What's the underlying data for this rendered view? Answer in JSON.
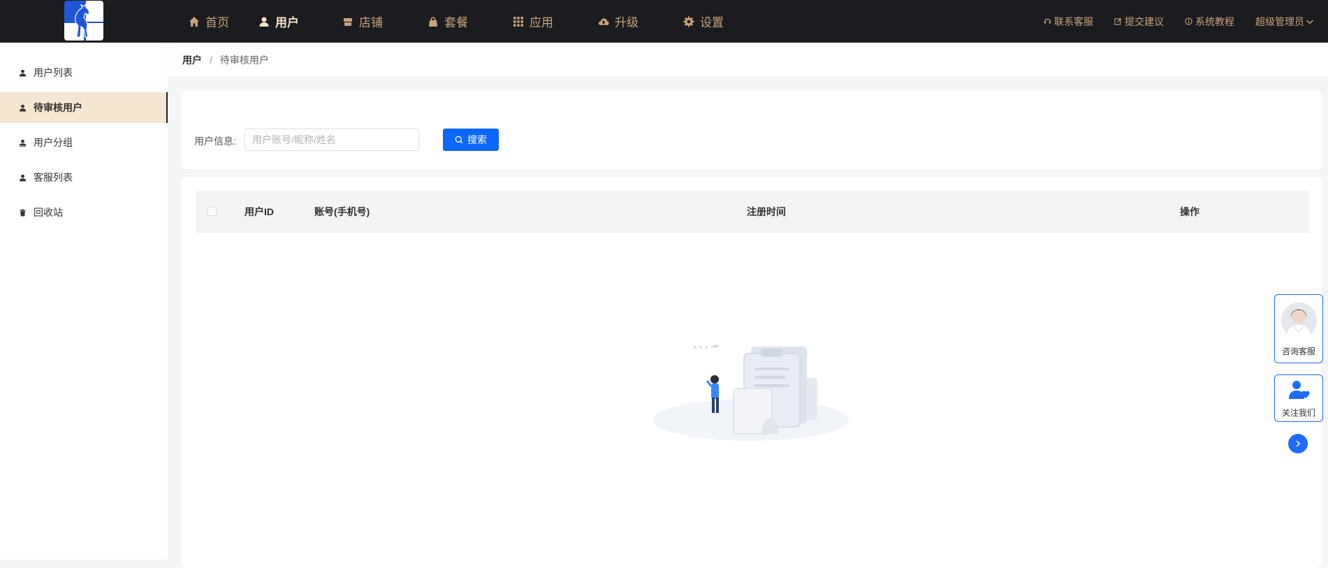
{
  "nav": {
    "items": [
      {
        "label": "首页",
        "icon": "home-icon"
      },
      {
        "label": "用户",
        "icon": "user-icon",
        "active": true
      },
      {
        "label": "店铺",
        "icon": "shop-icon"
      },
      {
        "label": "套餐",
        "icon": "bag-icon"
      },
      {
        "label": "应用",
        "icon": "grid-icon"
      },
      {
        "label": "升级",
        "icon": "cloud-upload-icon"
      },
      {
        "label": "设置",
        "icon": "gear-icon"
      }
    ],
    "right": [
      {
        "label": "联系客服",
        "icon": "headset-icon"
      },
      {
        "label": "提交建议",
        "icon": "edit-icon"
      },
      {
        "label": "系统教程",
        "icon": "info-icon"
      }
    ],
    "admin_label": "超级管理员"
  },
  "sidebar": {
    "items": [
      {
        "label": "用户列表",
        "icon": "user-icon"
      },
      {
        "label": "待审核用户",
        "icon": "user-icon",
        "active": true
      },
      {
        "label": "用户分组",
        "icon": "user-group-icon"
      },
      {
        "label": "客服列表",
        "icon": "user-icon"
      },
      {
        "label": "回收站",
        "icon": "trash-icon"
      }
    ]
  },
  "breadcrumb": {
    "first": "用户",
    "sep": "/",
    "current": "待审核用户"
  },
  "search": {
    "label": "用户信息:",
    "placeholder": "用户账号/昵称/姓名",
    "value": "",
    "button_label": "搜索"
  },
  "table": {
    "columns": [
      "用户ID",
      "账号(手机号)",
      "注册时间",
      "操作"
    ],
    "rows": []
  },
  "floating": {
    "consult_label": "咨询客服",
    "follow_label": "关注我们"
  },
  "colors": {
    "topbar": "#1b1c1f",
    "nav_text": "#c9a27a",
    "nav_active": "#f4e2c8",
    "sidebar_active_bg": "#f5e6d2",
    "primary": "#0d66ff"
  }
}
